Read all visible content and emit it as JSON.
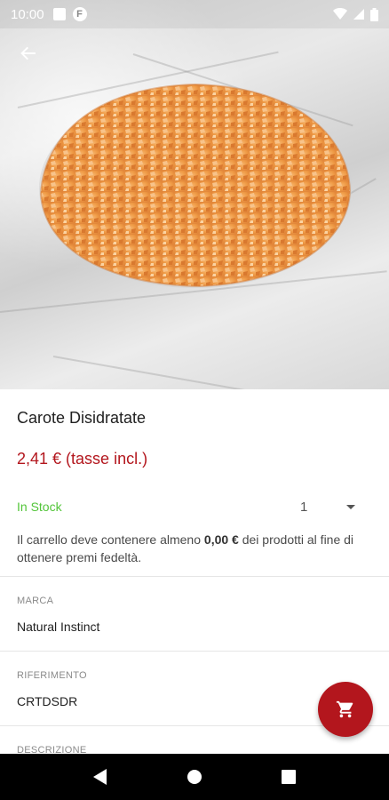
{
  "status_bar": {
    "time": "10:00",
    "icons": [
      "notification-square-icon",
      "f-badge-icon",
      "wifi-icon",
      "signal-icon",
      "battery-icon"
    ]
  },
  "header": {
    "back_icon": "arrow-back-icon"
  },
  "product": {
    "title": "Carote Disidratate",
    "price": "2,41 € (tasse incl.)",
    "stock_status": "In Stock",
    "quantity": "1",
    "loyalty_prefix": "Il carrello deve contenere almeno ",
    "loyalty_amount": "0,00 €",
    "loyalty_suffix": " dei prodotti al fine di ottenere premi fedeltà."
  },
  "details": {
    "brand_label": "MARCA",
    "brand_value": "Natural Instinct",
    "reference_label": "RIFERIMENTO",
    "reference_value": "CRTDSDR",
    "description_label": "DESCRIZIONE"
  },
  "fab": {
    "icon": "cart-icon"
  },
  "nav_bar": {
    "icons": [
      "back-triangle-icon",
      "home-circle-icon",
      "recents-square-icon"
    ]
  },
  "colors": {
    "accent": "#b3161d",
    "stock": "#53c53a",
    "carrot": "#f0a04a"
  }
}
